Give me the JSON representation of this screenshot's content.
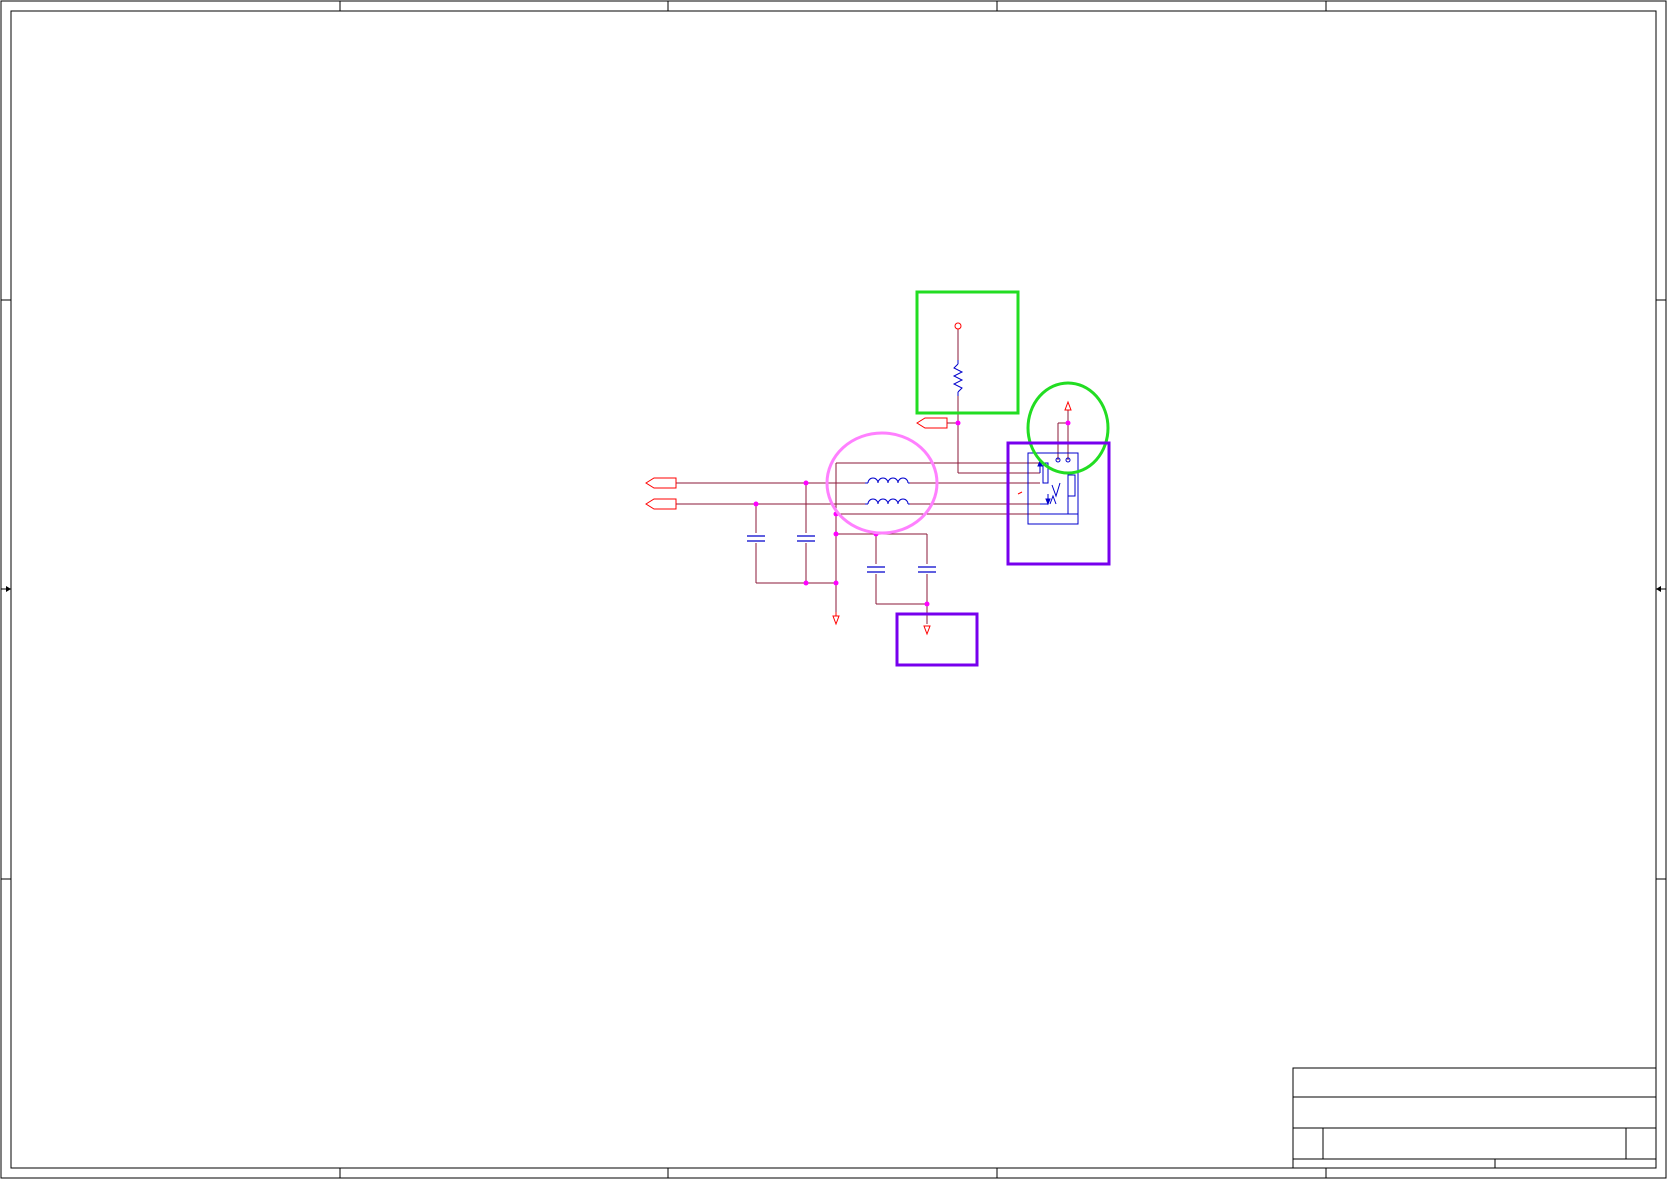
{
  "colors": {
    "border": "#000000",
    "wire": "#8b1a3a",
    "component": "#0000cc",
    "port": "#ff0000",
    "junction": "#ff00ff",
    "highlight_green": "#22dd22",
    "highlight_purple": "#7700ee",
    "highlight_pink": "#ff80ff"
  },
  "icons": {
    "resistor": "resistor-icon",
    "inductor": "inductor-icon",
    "capacitor": "capacitor-icon",
    "ground": "ground-icon",
    "power": "power-icon",
    "port": "off-sheet-port-icon",
    "connector": "usb-connector-icon"
  }
}
